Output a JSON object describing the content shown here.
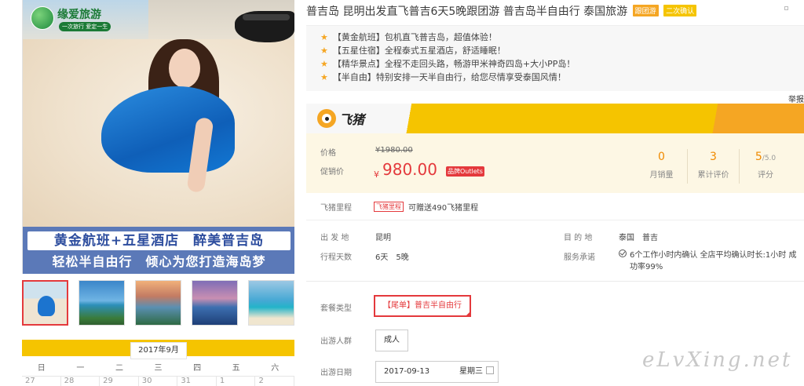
{
  "gallery": {
    "logo_text": "缘爱旅游",
    "logo_sub": "一次旅行 爱定一生",
    "banner_line1": "黄金航班+五星酒店　醉美普吉岛",
    "banner_line2": "轻松半自由行　倾心为您打造海岛梦",
    "thumbnails": [
      "beach-woman",
      "island-bay",
      "sunset-resort",
      "purple-sunset",
      "longtail-boat"
    ]
  },
  "calendar": {
    "month": "2017年9月",
    "weekdays": [
      "日",
      "一",
      "二",
      "三",
      "四",
      "五",
      "六"
    ],
    "days": [
      "27",
      "28",
      "29",
      "30",
      "31",
      "1",
      "2"
    ]
  },
  "product": {
    "title": "普吉岛 昆明出发直飞普吉6天5晚跟团游 普吉岛半自由行 泰国旅游",
    "tag_group": "跟团游",
    "tag_confirm": "二次确认",
    "highlights": [
      "【黄金航班】包机直飞普吉岛，超值体验！",
      "【五星住宿】全程泰式五星酒店，舒适睡眠！",
      "【精华景点】全程不走回头路，畅游甲米神奇四岛+大小PP岛！",
      "【半自由】特别安排一天半自由行，给您尽情享受泰国风情！"
    ],
    "more_text": "举报"
  },
  "brand": {
    "name": "飞猪"
  },
  "price": {
    "orig_label": "价格",
    "orig_value": "¥1980.00",
    "sale_label": "促销价",
    "currency": "¥",
    "sale_value": "980.00",
    "outlets_badge": "品牌Outlets"
  },
  "stats": [
    {
      "value": "0",
      "suffix": "",
      "label": "月销量"
    },
    {
      "value": "3",
      "suffix": "",
      "label": "累计评价"
    },
    {
      "value": "5",
      "suffix": "/5.0",
      "label": "评分"
    }
  ],
  "mileage": {
    "label": "飞猪里程",
    "tag": "飞猪里程",
    "text": "可赠送490飞猪里程"
  },
  "info": {
    "depart_label": "出 发 地",
    "depart_value": "昆明",
    "dest_label": "目 的 地",
    "dest_value": "泰国　普吉",
    "days_label": "行程天数",
    "days_value": "6天　5晚",
    "service_label": "服务承诺",
    "service_value": "6个工作小时内确认 全店平均确认时长:1小时 成功率99%"
  },
  "options": {
    "package_label": "套餐类型",
    "package_value": "【尾单】普吉半自由行",
    "people_label": "出游人群",
    "people_value": "成人",
    "date_label": "出游日期",
    "date_value": "2017-09-13",
    "date_weekday": "星期三"
  },
  "watermark": "eLvXing.net"
}
